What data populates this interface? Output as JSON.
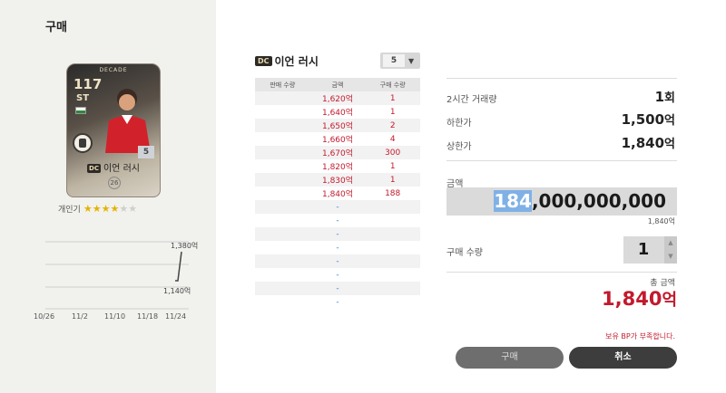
{
  "dialog": {
    "title": "구매"
  },
  "card": {
    "decade_label": "DECADE",
    "ovr": "117",
    "position": "ST",
    "level": "5",
    "season_badge": "DC",
    "player_name": "이언 러시",
    "age": "26",
    "popularity_label": "개인기",
    "stars": {
      "filled": 4,
      "total": 6
    },
    "icons": [
      "flag-icon",
      "team-emblem-icon"
    ]
  },
  "price_chart": {
    "chart_data": {
      "type": "line",
      "x": [
        "10/26",
        "11/2",
        "11/10",
        "11/18",
        "11/24"
      ],
      "labels": {
        "high": "1,380억",
        "low": "1,140억"
      },
      "values_shown": [
        "1,140억",
        "1,380억"
      ]
    }
  },
  "listing": {
    "badge": "DC",
    "player_name": "이언 러시",
    "level_select": "5",
    "columns": [
      "판매 수량",
      "금액",
      "구매 수량"
    ],
    "rows": [
      {
        "sell": "",
        "price": "1,620억",
        "buy": "1"
      },
      {
        "sell": "",
        "price": "1,640억",
        "buy": "1"
      },
      {
        "sell": "",
        "price": "1,650억",
        "buy": "2"
      },
      {
        "sell": "",
        "price": "1,660억",
        "buy": "4"
      },
      {
        "sell": "",
        "price": "1,670억",
        "buy": "300"
      },
      {
        "sell": "",
        "price": "1,820억",
        "buy": "1"
      },
      {
        "sell": "",
        "price": "1,830억",
        "buy": "1"
      },
      {
        "sell": "",
        "price": "1,840억",
        "buy": "188"
      },
      {
        "sell": "",
        "price": "-",
        "buy": ""
      },
      {
        "sell": "",
        "price": "-",
        "buy": ""
      },
      {
        "sell": "",
        "price": "-",
        "buy": ""
      },
      {
        "sell": "",
        "price": "-",
        "buy": ""
      },
      {
        "sell": "",
        "price": "-",
        "buy": ""
      },
      {
        "sell": "",
        "price": "-",
        "buy": ""
      },
      {
        "sell": "",
        "price": "-",
        "buy": ""
      },
      {
        "sell": "",
        "price": "-",
        "buy": ""
      }
    ]
  },
  "stats": {
    "volume_label": "2시간 거래량",
    "volume_value": "1",
    "volume_unit": "회",
    "min_label": "하한가",
    "min_value": "1,500",
    "min_unit": "억",
    "max_label": "상한가",
    "max_value": "1,840",
    "max_unit": "억"
  },
  "amount": {
    "label": "금액",
    "value_selected": "184",
    "value_rest": ",000,000,000",
    "sub": "1,840억"
  },
  "quantity": {
    "label": "구매 수량",
    "value": "1"
  },
  "total": {
    "label": "총 금액",
    "value": "1,840",
    "unit": "억"
  },
  "warning": "보유 BP가 부족합니다.",
  "buttons": {
    "buy": "구매",
    "cancel": "취소"
  }
}
